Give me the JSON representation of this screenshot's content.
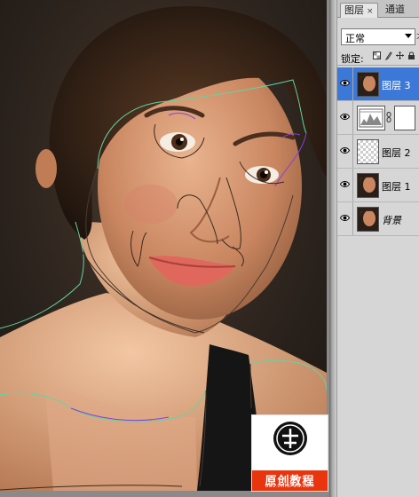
{
  "canvas": {
    "description_icon": "portrait-photo"
  },
  "panel": {
    "tabs": [
      {
        "label": "图层",
        "close": "×"
      },
      {
        "label": "通道"
      }
    ],
    "blend_mode": "正常",
    "mode_extra": "不",
    "lock_label": "锁定:",
    "lock_icons": [
      "lock-transparent-icon",
      "lock-paint-icon",
      "lock-move-icon",
      "lock-all-icon"
    ],
    "layers": [
      {
        "name": "图层 3",
        "selected": true
      },
      {
        "name": "",
        "type": "adjustment"
      },
      {
        "name": "图层 2"
      },
      {
        "name": "图层 1"
      },
      {
        "name": "背景"
      }
    ]
  },
  "watermark": {
    "title": "原创教程",
    "url": "BBS.CHINFUN.COM"
  },
  "colors": {
    "selected_layer": "#3c78d7",
    "panel_bg": "#d6d6d6",
    "watermark_band": "#e8350e",
    "path_green": "#5fd6a0",
    "path_purple": "#8a3fd6"
  }
}
